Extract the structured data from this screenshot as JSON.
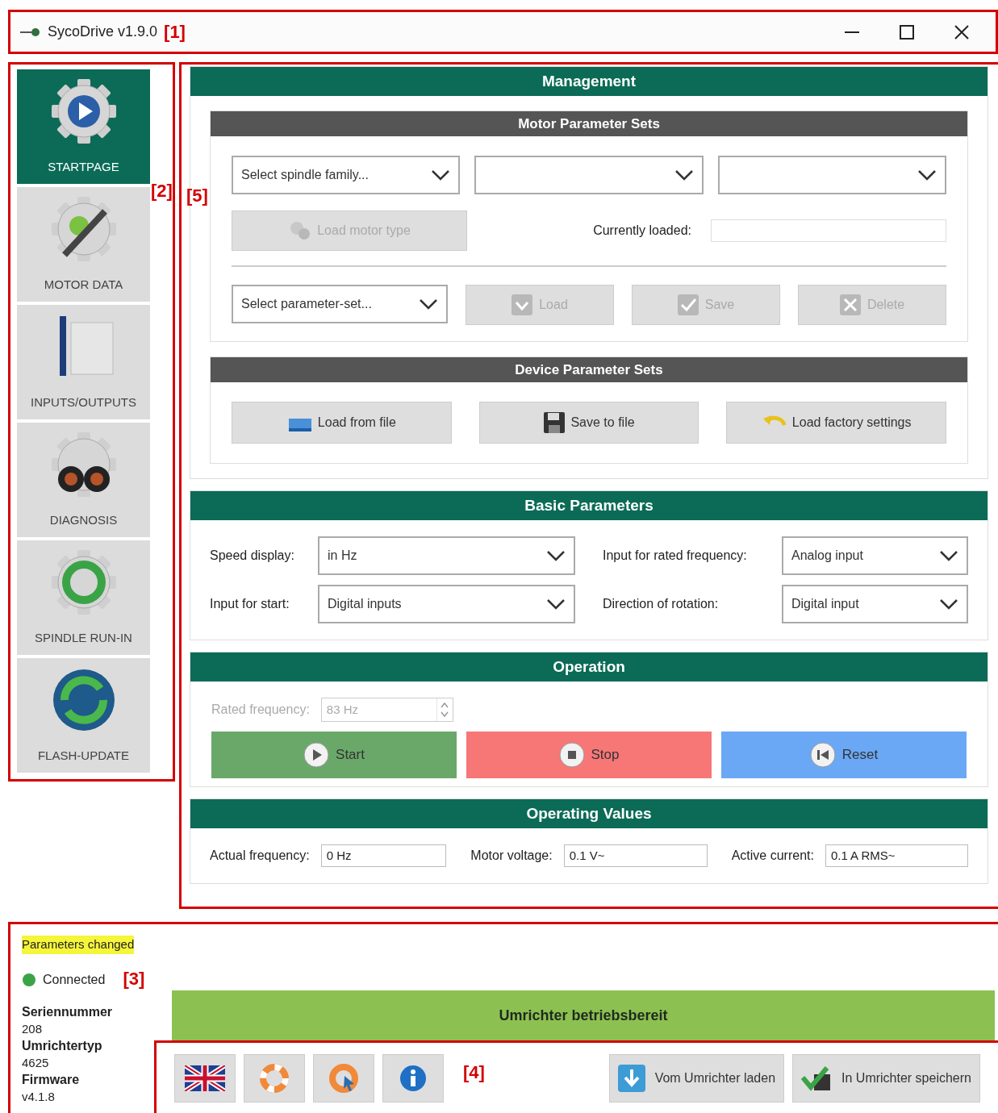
{
  "window": {
    "title": "SycoDrive v1.9.0",
    "marker": "[1]"
  },
  "sidebar": {
    "marker": "[2]",
    "items": [
      {
        "label": "STARTPAGE",
        "kind": "start",
        "selected": true
      },
      {
        "label": "MOTOR DATA",
        "kind": "motor",
        "selected": false
      },
      {
        "label": "INPUTS/OUTPUTS",
        "kind": "io",
        "selected": false
      },
      {
        "label": "DIAGNOSIS",
        "kind": "diag",
        "selected": false
      },
      {
        "label": "SPINDLE RUN-IN",
        "kind": "runin",
        "selected": false
      },
      {
        "label": "FLASH-UPDATE",
        "kind": "flash",
        "selected": false
      }
    ]
  },
  "main": {
    "marker": "[5]",
    "management": {
      "title": "Management",
      "motor_sets": {
        "title": "Motor Parameter Sets",
        "selects": [
          {
            "kind": "dropdown",
            "placeholder": "Select spindle family..."
          },
          {
            "kind": "dropdown"
          },
          {
            "kind": "dropdown"
          }
        ],
        "load_motor_type": {
          "label": "Load motor type",
          "disabled": true
        },
        "currently_loaded_label": "Currently loaded:",
        "parameter_select": {
          "placeholder": "Select parameter-set..."
        },
        "actions": [
          {
            "label": "Load",
            "kind": "load",
            "disabled": true
          },
          {
            "label": "Save",
            "kind": "save",
            "disabled": true
          },
          {
            "label": "Delete",
            "kind": "delete",
            "disabled": true
          }
        ]
      },
      "device_sets": {
        "title": "Device Parameter Sets",
        "buttons": [
          {
            "label": "Load from file",
            "kind": "open"
          },
          {
            "label": "Save to file",
            "kind": "floppy"
          },
          {
            "label": "Load factory settings",
            "kind": "undo"
          }
        ]
      }
    },
    "basic": {
      "title": "Basic Parameters",
      "fields": [
        {
          "label": "Speed display:",
          "value": "in Hz"
        },
        {
          "label": "Input for rated frequency:",
          "value": "Analog input"
        },
        {
          "label": "Input for start:",
          "value": "Digital inputs"
        },
        {
          "label": "Direction of rotation:",
          "value": "Digital input"
        }
      ]
    },
    "operation": {
      "title": "Operation",
      "rated_frequency": {
        "label": "Rated frequency:",
        "value": "83 Hz",
        "disabled": true
      },
      "buttons": [
        {
          "label": "Start",
          "kind": "start"
        },
        {
          "label": "Stop",
          "kind": "stop"
        },
        {
          "label": "Reset",
          "kind": "reset"
        }
      ]
    },
    "operating_values": {
      "title": "Operating Values",
      "fields": [
        {
          "label": "Actual frequency:",
          "value": "0 Hz"
        },
        {
          "label": "Motor voltage:",
          "value": "0.1 V~"
        },
        {
          "label": "Active current:",
          "value": "0.1 A RMS~"
        }
      ]
    }
  },
  "status": {
    "marker": "[3]",
    "parameters_changed": "Parameters changed",
    "connection": {
      "label": "Connected",
      "connected": true
    },
    "info": [
      {
        "label": "Seriennummer",
        "value": "208"
      },
      {
        "label": "Umrichtertyp",
        "value": "4625"
      },
      {
        "label": "Firmware",
        "value": "v4.1.8"
      }
    ],
    "banner": "Umrichter betriebsbereit"
  },
  "toolbar": {
    "marker": "[4]",
    "icon_buttons": [
      {
        "kind": "flag"
      },
      {
        "kind": "lifebuoy"
      },
      {
        "kind": "lifebuoy-cursor"
      },
      {
        "kind": "info"
      }
    ],
    "buttons": [
      {
        "label": "Vom Umrichter laden",
        "kind": "download"
      },
      {
        "label": "In Umrichter speichern",
        "kind": "store"
      }
    ]
  }
}
